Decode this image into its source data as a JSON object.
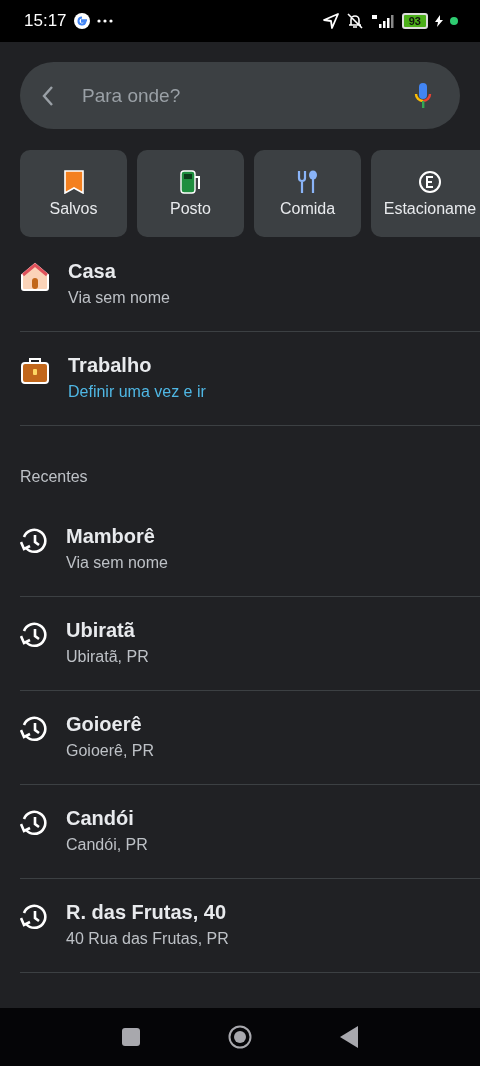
{
  "status_bar": {
    "time": "15:17",
    "battery": "93"
  },
  "search": {
    "placeholder": "Para onde?"
  },
  "chips": [
    {
      "kind": "saved",
      "label": "Salvos"
    },
    {
      "kind": "gas",
      "label": "Posto"
    },
    {
      "kind": "food",
      "label": "Comida"
    },
    {
      "kind": "parking",
      "label": "Estacioname"
    }
  ],
  "saved_places": [
    {
      "kind": "home",
      "title": "Casa",
      "subtitle": "Via sem nome",
      "action": false
    },
    {
      "kind": "work",
      "title": "Trabalho",
      "subtitle": "Definir uma vez e ir",
      "action": true
    }
  ],
  "recent_heading": "Recentes",
  "recents": [
    {
      "title": "Mamborê",
      "subtitle": "Via sem nome"
    },
    {
      "title": "Ubiratã",
      "subtitle": "Ubiratã, PR"
    },
    {
      "title": "Goioerê",
      "subtitle": "Goioerê, PR"
    },
    {
      "title": "Candói",
      "subtitle": "Candói, PR"
    },
    {
      "title": "R. das Frutas, 40",
      "subtitle": "40 Rua das Frutas, PR"
    }
  ]
}
